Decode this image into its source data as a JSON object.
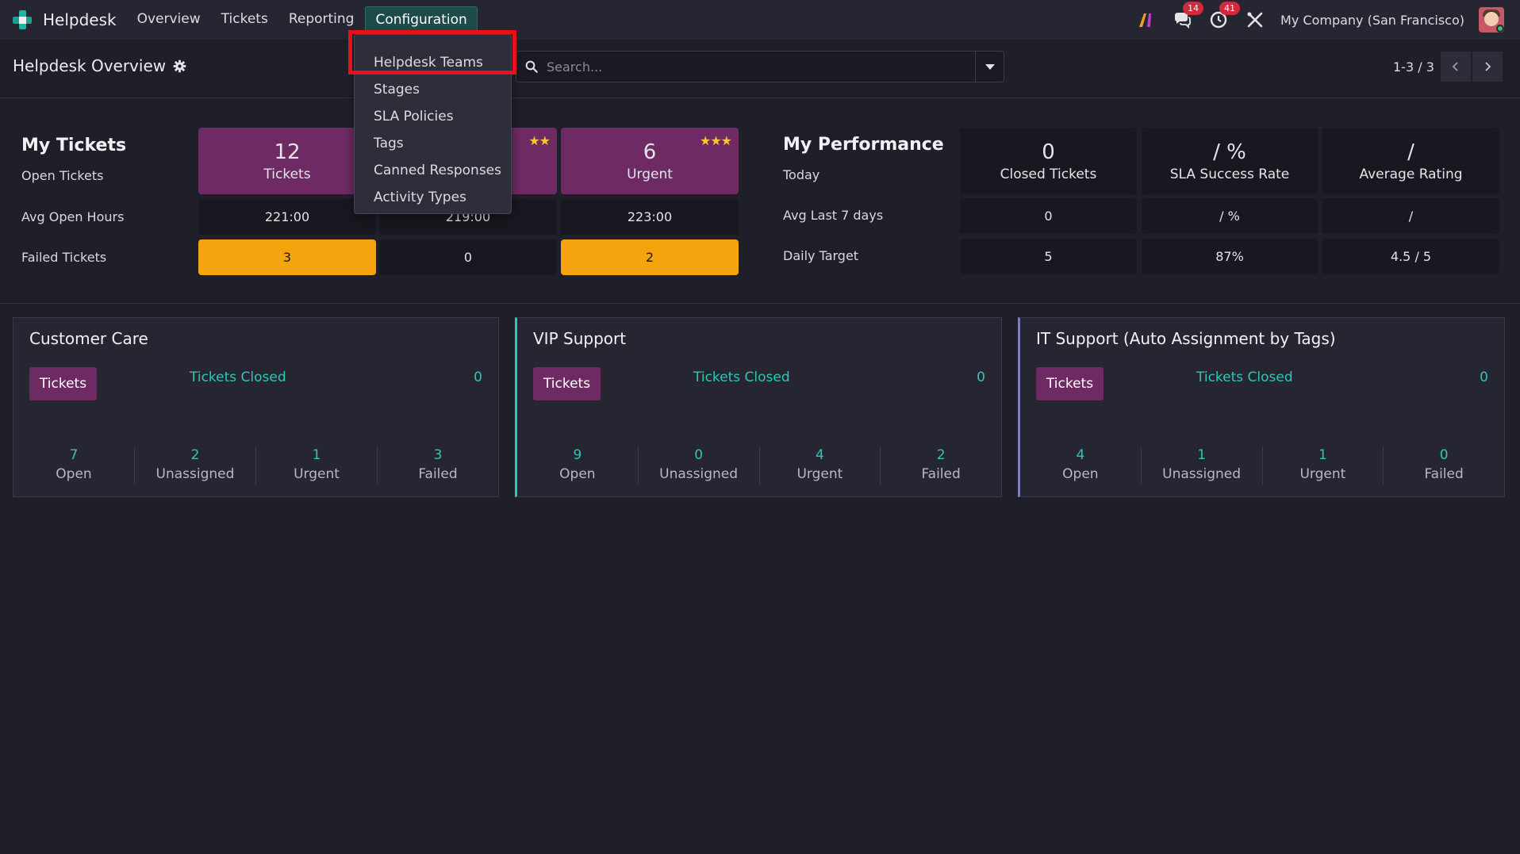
{
  "navbar": {
    "app_name": "Helpdesk",
    "menu": [
      "Overview",
      "Tickets",
      "Reporting",
      "Configuration"
    ],
    "messages_badge": "14",
    "activities_badge": "41",
    "company": "My Company (San Francisco)"
  },
  "control": {
    "title": "Helpdesk Overview",
    "search_placeholder": "Search...",
    "pager": "1-3 / 3"
  },
  "config_dropdown": {
    "items": [
      "Helpdesk Teams",
      "Stages",
      "SLA Policies",
      "Tags",
      "Canned Responses",
      "Activity Types"
    ]
  },
  "my_tickets": {
    "title": "My Tickets",
    "row_labels": [
      "Open Tickets",
      "Avg Open Hours",
      "Failed Tickets"
    ],
    "tiles": [
      {
        "num": "12",
        "sub": "Tickets",
        "stars": ""
      },
      {
        "num": "",
        "sub": "",
        "stars": "★★"
      },
      {
        "num": "6",
        "sub": "Urgent",
        "stars": "★★★"
      }
    ],
    "avg_hours": [
      "221:00",
      "219:00",
      "223:00"
    ],
    "failed": [
      "3",
      "0",
      "2"
    ]
  },
  "my_performance": {
    "title": "My Performance",
    "row_labels": [
      "Today",
      "Avg Last 7 days",
      "Daily Target"
    ],
    "tiles": [
      {
        "num": "0",
        "sub": "Closed Tickets"
      },
      {
        "num": "/ %",
        "sub": "SLA Success Rate"
      },
      {
        "num": "/",
        "sub": "Average Rating"
      }
    ],
    "avg7": [
      "0",
      "/ %",
      "/"
    ],
    "target": [
      "5",
      "87%",
      "4.5 / 5"
    ]
  },
  "teams": [
    {
      "name": "Customer Care",
      "tickets_label": "Tickets",
      "closed_label": "Tickets Closed",
      "closed": "0",
      "stats": [
        {
          "n": "7",
          "t": "Open"
        },
        {
          "n": "2",
          "t": "Unassigned"
        },
        {
          "n": "1",
          "t": "Urgent"
        },
        {
          "n": "3",
          "t": "Failed"
        }
      ]
    },
    {
      "name": "VIP Support",
      "tickets_label": "Tickets",
      "closed_label": "Tickets Closed",
      "closed": "0",
      "stats": [
        {
          "n": "9",
          "t": "Open"
        },
        {
          "n": "0",
          "t": "Unassigned"
        },
        {
          "n": "4",
          "t": "Urgent"
        },
        {
          "n": "2",
          "t": "Failed"
        }
      ]
    },
    {
      "name": "IT Support (Auto Assignment by Tags)",
      "tickets_label": "Tickets",
      "closed_label": "Tickets Closed",
      "closed": "0",
      "stats": [
        {
          "n": "4",
          "t": "Open"
        },
        {
          "n": "1",
          "t": "Unassigned"
        },
        {
          "n": "1",
          "t": "Urgent"
        },
        {
          "n": "0",
          "t": "Failed"
        }
      ]
    }
  ],
  "colors": {
    "accent_teal": "#2dc7b6",
    "tile_purple": "#6e2a63",
    "tile_orange": "#f5a30f",
    "highlight_red": "#e8101a",
    "vip_border": "#2dc7b6",
    "it_border": "#6f7fd1"
  }
}
